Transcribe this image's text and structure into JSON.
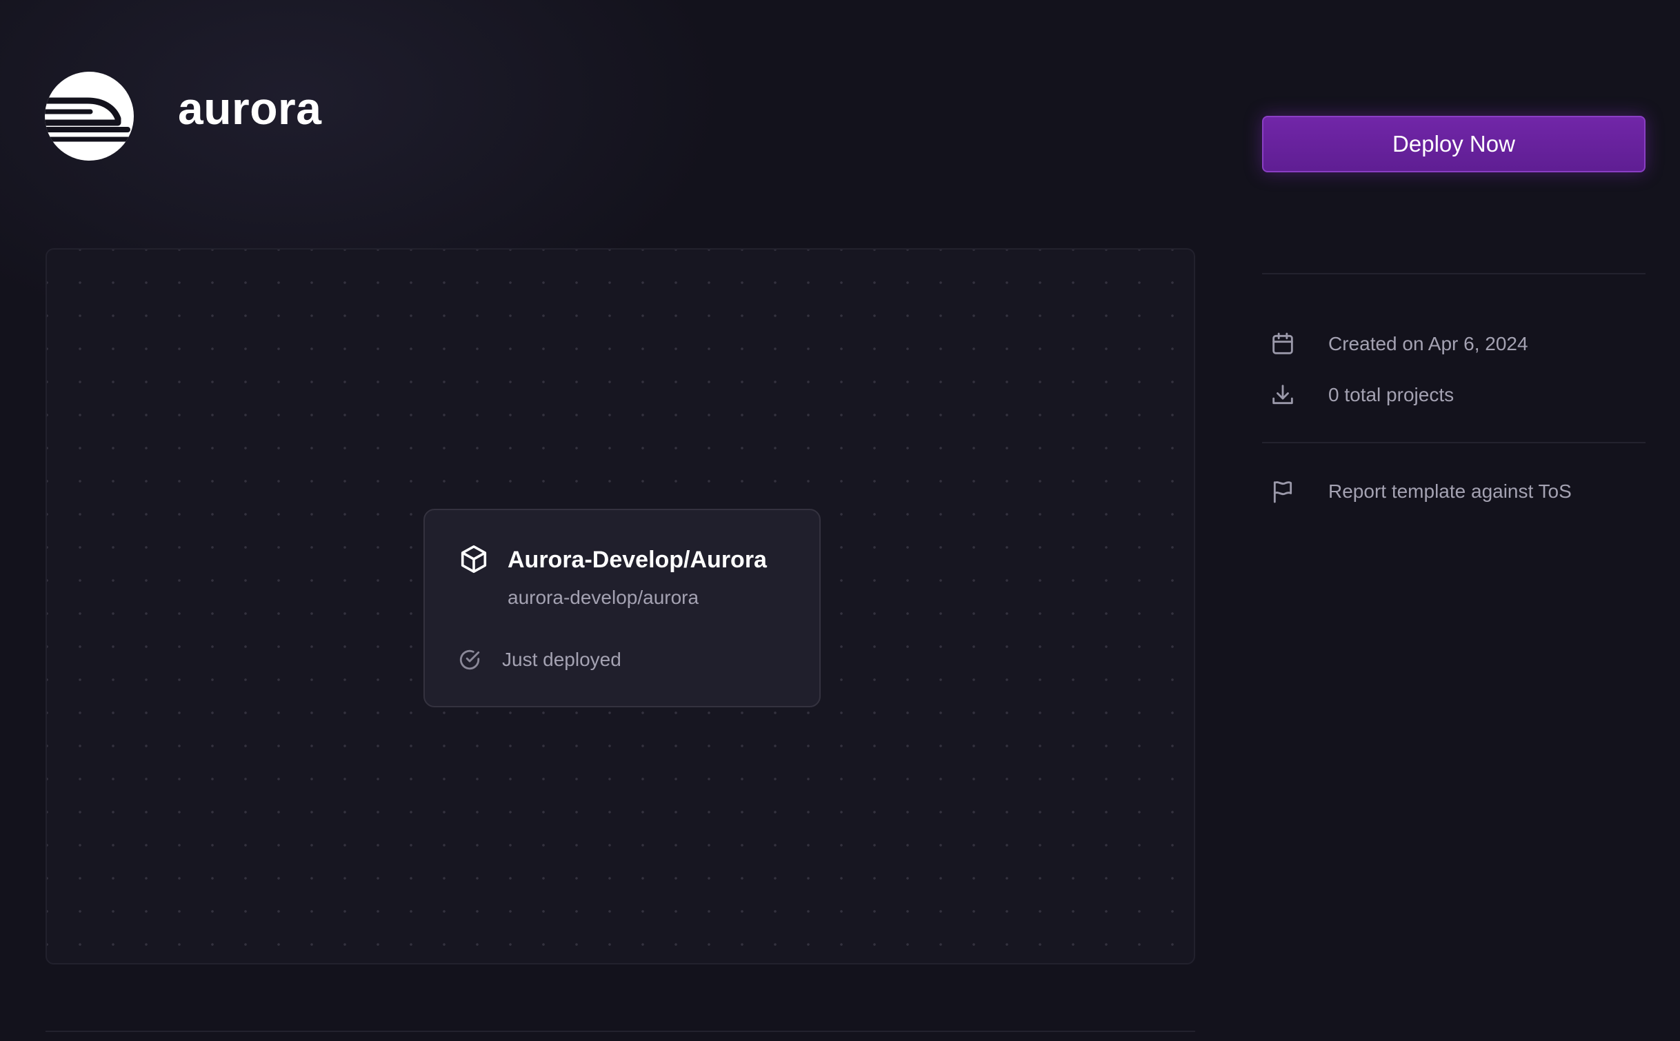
{
  "header": {
    "title": "aurora",
    "logo_icon": "aurora-train-logo"
  },
  "actions": {
    "deploy_label": "Deploy Now",
    "accent_color": "#6a22a0"
  },
  "canvas": {
    "service": {
      "name": "Aurora-Develop/Aurora",
      "repo": "aurora-develop/aurora",
      "status": "Just deployed",
      "icon": "cube-icon",
      "status_icon": "check-circle-icon"
    }
  },
  "sidebar": {
    "created": {
      "icon": "calendar-icon",
      "text": "Created on Apr 6, 2024"
    },
    "projects": {
      "icon": "download-icon",
      "text": "0 total projects"
    },
    "report": {
      "icon": "flag-icon",
      "text": "Report template against ToS"
    }
  }
}
